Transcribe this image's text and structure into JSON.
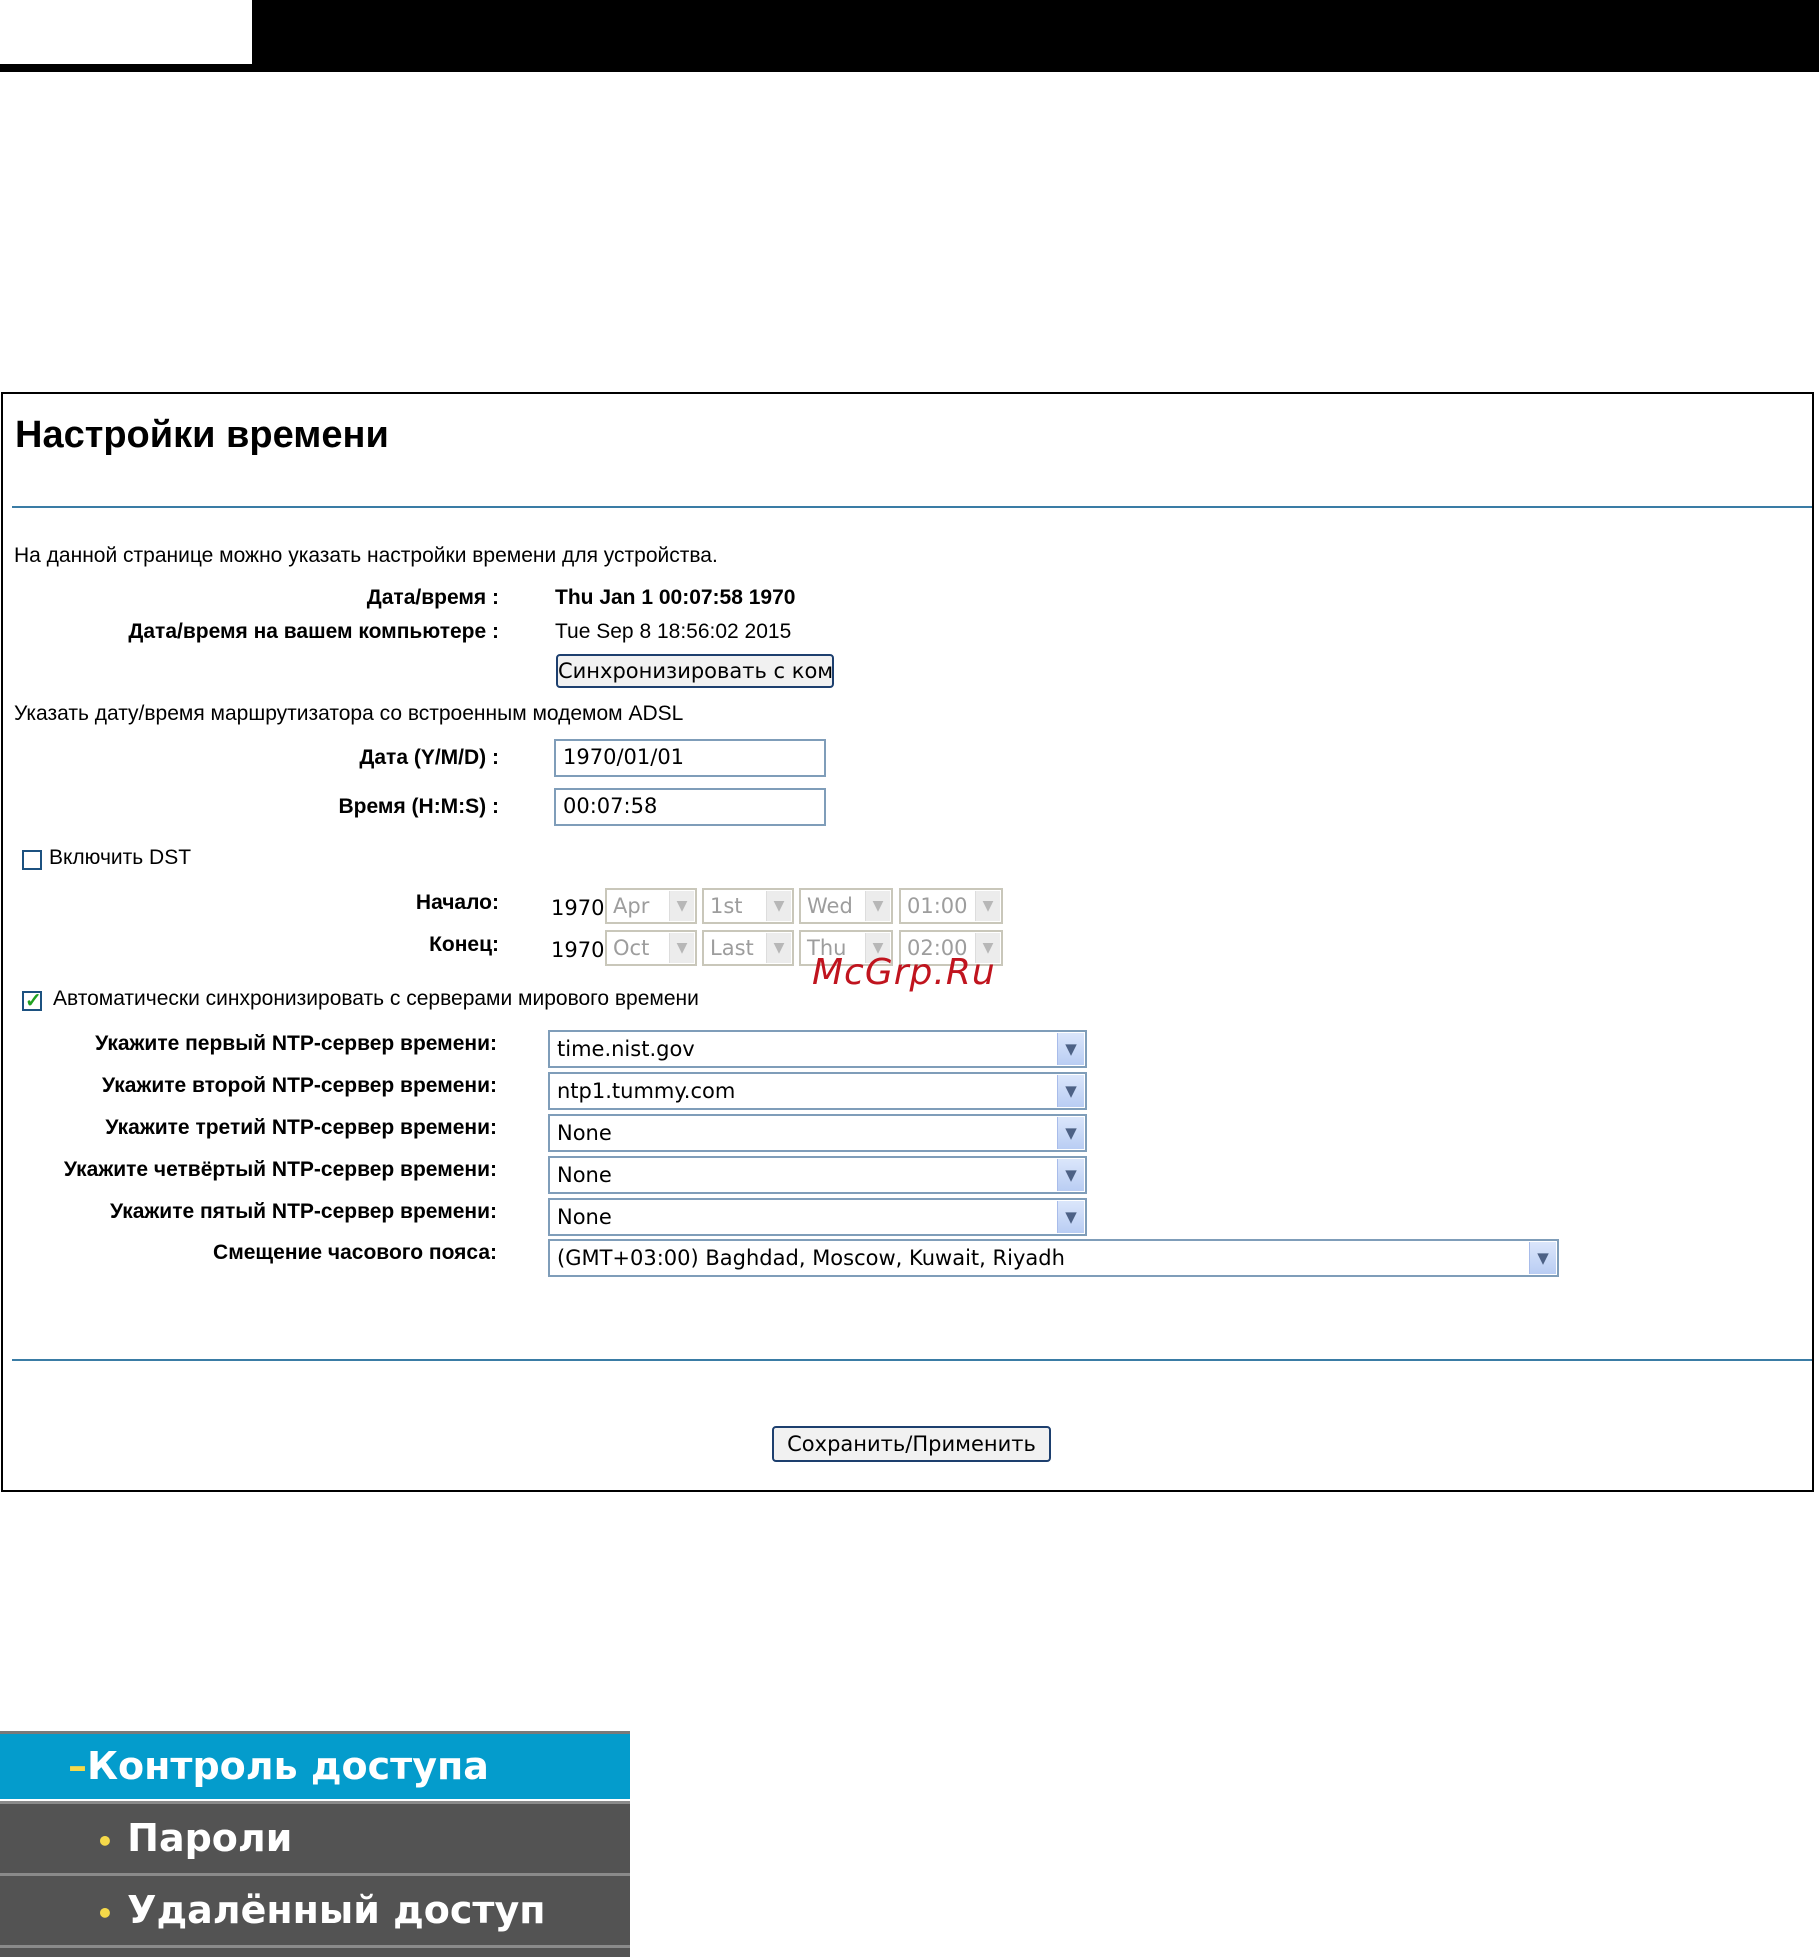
{
  "panel": {
    "title": "Настройки времени",
    "description": "На данной странице можно указать настройки времени для устройства.",
    "datetime_label": "Дата/время :",
    "datetime_value": "Thu Jan 1 00:07:58 1970",
    "pc_datetime_label": "Дата/время на вашем компьютере :",
    "pc_datetime_value": "Tue Sep 8 18:56:02 2015",
    "sync_button": "Синхронизировать с компьютером",
    "manual_text": "Указать дату/время маршрутизатора со встроенным модемом ADSL",
    "date_label": "Дата (Y/M/D) :",
    "date_value": "1970/01/01",
    "time_label": "Время (H:M:S) :",
    "time_value": "00:07:58",
    "dst_label": "Включить DST",
    "dst_checked": false,
    "dst_start_label": "Начало:",
    "dst_end_label": "Конец:",
    "dst_start": {
      "year": "1970",
      "month": "Apr",
      "week": "1st",
      "day": "Wed",
      "time": "01:00"
    },
    "dst_end": {
      "year": "1970",
      "month": "Oct",
      "week": "Last",
      "day": "Thu",
      "time": "02:00"
    },
    "auto_sync_label": "Автоматически синхронизировать с серверами мирового времени",
    "auto_sync_checked": true,
    "ntp1_label": "Укажите первый NTP-сервер времени:",
    "ntp1_value": "time.nist.gov",
    "ntp2_label": "Укажите второй NTP-сервер времени:",
    "ntp2_value": "ntp1.tummy.com",
    "ntp3_label": "Укажите третий NTP-сервер времени:",
    "ntp3_value": "None",
    "ntp4_label": "Укажите четвёртый NTP-сервер времени:",
    "ntp4_value": "None",
    "ntp5_label": "Укажите пятый NTP-сервер времени:",
    "ntp5_value": "None",
    "tz_label": "Смещение часового пояса:",
    "tz_value": "(GMT+03:00) Baghdad, Moscow, Kuwait, Riyadh",
    "save_button": "Сохранить/Применить"
  },
  "watermark": "McGrp.Ru",
  "menu": {
    "active_label": "Контроль доступа",
    "items": [
      "Пароли",
      "Удалённый доступ"
    ]
  },
  "colors": {
    "accent_rule": "#3a7ca5",
    "menu_active": "#049ccc",
    "menu_item": "#535353",
    "watermark": "#c0141e"
  }
}
